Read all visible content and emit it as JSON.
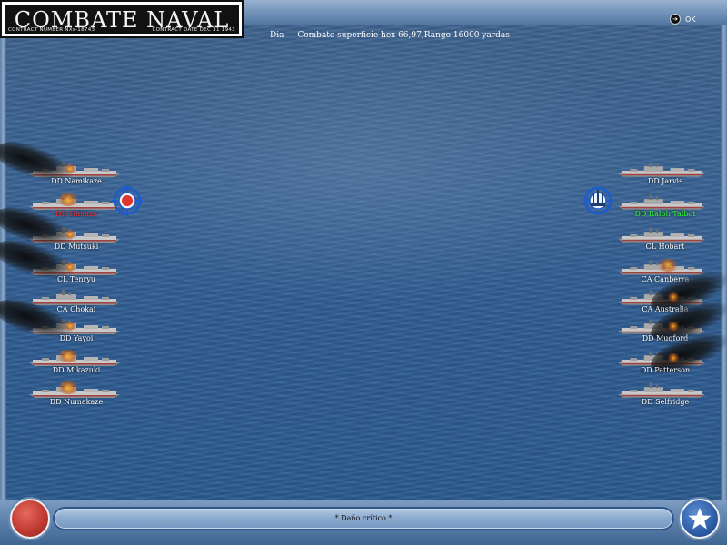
{
  "header": {
    "logo_title": "COMBATE NAVAL",
    "contract_number": "CONTRACT NUMBER NXs-18743",
    "contract_date": "CONTRACT DATE DEC 31 1943",
    "ok_label": "OK"
  },
  "info": {
    "day": "Dia",
    "text": "Combate superficie hex 66,97,Rango 16000 yardas"
  },
  "left_fleet": [
    {
      "name": "DD Namikaze",
      "state": "burning"
    },
    {
      "name": "DD Hakaze",
      "state": "selected"
    },
    {
      "name": "DD Mutsuki",
      "state": "burning"
    },
    {
      "name": "CL Tenryu",
      "state": "burning"
    },
    {
      "name": "CA Chokai",
      "state": "normal"
    },
    {
      "name": "DD Yayoi",
      "state": "burning"
    },
    {
      "name": "DD Mikazuki",
      "state": "damaged"
    },
    {
      "name": "DD Numakaze",
      "state": "damaged"
    }
  ],
  "right_fleet": [
    {
      "name": "DD Jarvis",
      "state": "normal"
    },
    {
      "name": "DD Ralph Talbot",
      "state": "target"
    },
    {
      "name": "CL Hobart",
      "state": "normal"
    },
    {
      "name": "CA Canberra",
      "state": "damaged"
    },
    {
      "name": "CA Australia",
      "state": "burning"
    },
    {
      "name": "DD Mugford",
      "state": "burning"
    },
    {
      "name": "DD Patterson",
      "state": "burning"
    },
    {
      "name": "DD Selfridge",
      "state": "normal"
    }
  ],
  "status": {
    "message": "* Daño crítico *"
  },
  "colors": {
    "selected_label": "#ff2a2a",
    "target_label": "#33ff33",
    "normal_label": "#ffffff",
    "sea": "#3a6496",
    "marker_ring": "#1d5cc9",
    "marker_dot": "#e0352c"
  },
  "icons": {
    "ok": "arrow-right-circle-icon",
    "left_button": "red-circle-button",
    "right_button": "star-icon",
    "left_marker": "crosshair-target-icon",
    "right_marker": "ship-silhouette-target-icon"
  }
}
